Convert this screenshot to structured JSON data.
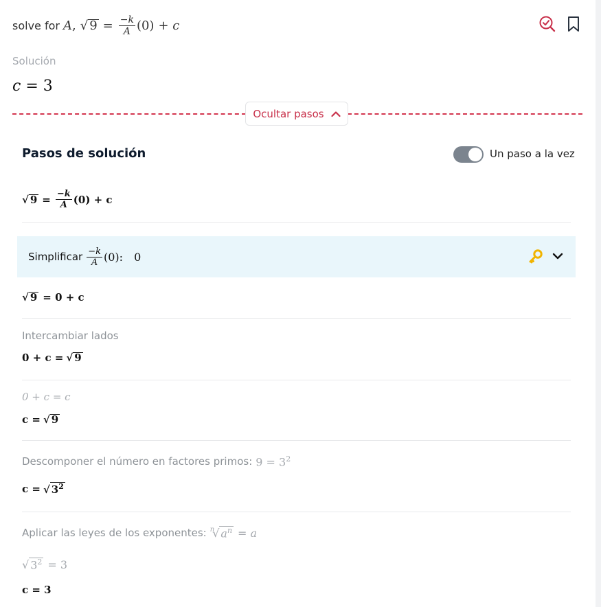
{
  "query": {
    "prefix": "solve for",
    "variable": "A",
    "sep": ",",
    "radicand": "9",
    "num": "−k",
    "den": "A",
    "paren": "(0)",
    "plus_c": "+ c"
  },
  "solution": {
    "label": "Solución",
    "var": "c",
    "eq": "=",
    "value": "3"
  },
  "toggle_steps": {
    "label": "Ocultar pasos"
  },
  "steps": {
    "title": "Pasos de solución",
    "one_step_label": "Un paso a la vez",
    "eq0": {
      "radicand": "9",
      "num": "−k",
      "den": "A",
      "rest": "(0) + c"
    },
    "simplify": {
      "label": "Simplificar",
      "num": "−k",
      "den": "A",
      "paren": "(0):",
      "result": "0"
    },
    "eq1": {
      "radicand": "9",
      "rest": "= 0 + c"
    },
    "swap": {
      "label": "Intercambiar lados",
      "eq_left": "0 + c =",
      "radicand": "9"
    },
    "hint1": {
      "text": "0 + c = c"
    },
    "eq2": {
      "left": "c =",
      "radicand": "9"
    },
    "factor": {
      "label": "Descomponer el número en factores primos:",
      "expr": "9 = 3",
      "exp": "2"
    },
    "eq3": {
      "left": "c =",
      "base": "3",
      "exp": "2"
    },
    "laws": {
      "label": "Aplicar las leyes de los exponentes:",
      "index": "n",
      "base": "a",
      "exp": "n",
      "result": "= a"
    },
    "hint2": {
      "base": "3",
      "exp": "2",
      "result": "= 3"
    },
    "final": {
      "text": "c = 3"
    }
  },
  "colors": {
    "accent": "#c8304a",
    "highlight_bg": "#e9f6fb",
    "key": "#f1b400"
  },
  "icons": [
    "search-check-icon",
    "bookmark-icon",
    "chevron-up-icon",
    "key-icon",
    "chevron-down-icon"
  ]
}
